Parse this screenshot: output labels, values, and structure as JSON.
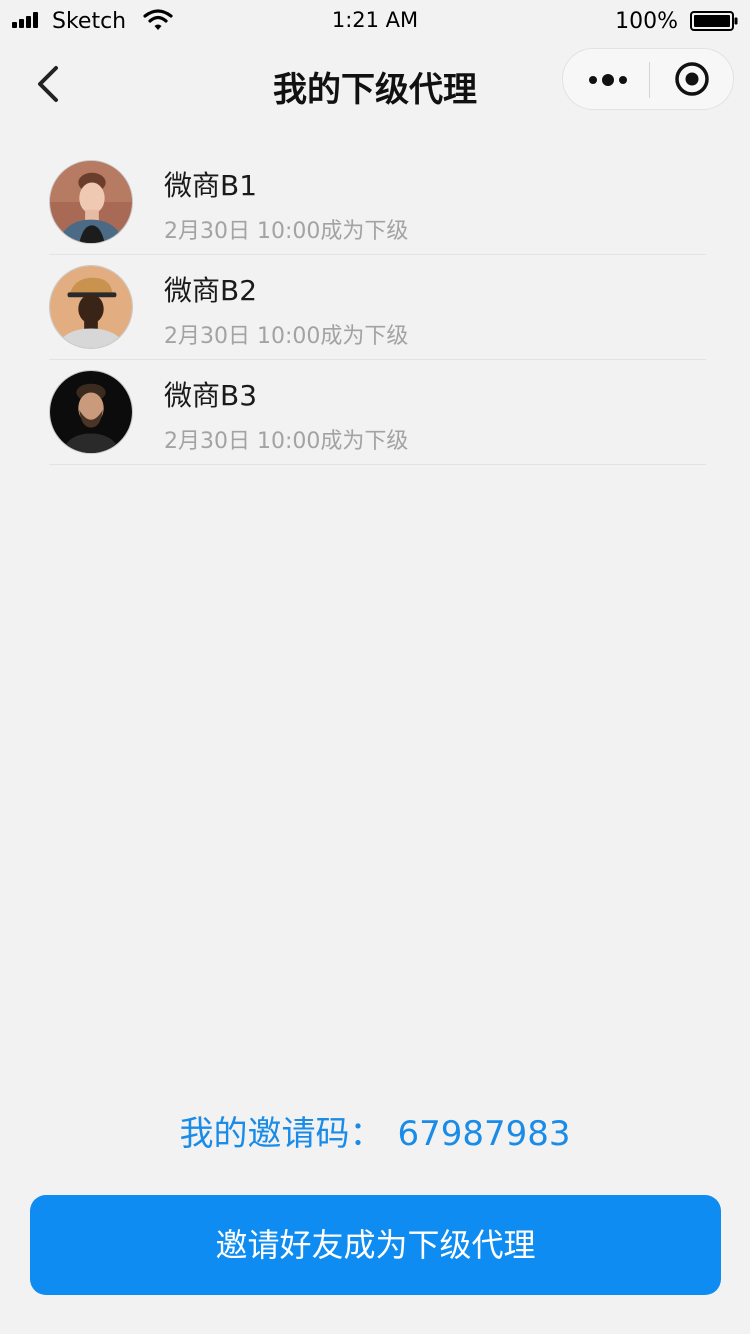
{
  "status_bar": {
    "carrier": "Sketch",
    "time": "1:21 AM",
    "battery_percent": "100%",
    "icons": [
      "signal-icon",
      "wifi-icon",
      "battery-icon"
    ]
  },
  "nav": {
    "title": "我的下级代理",
    "icons": [
      "chevron-left-icon",
      "more-dots-icon",
      "close-target-icon"
    ]
  },
  "agents": [
    {
      "name": "微商B1",
      "time": "2月30日 10:00成为下级",
      "avatar_icon": "avatar-photo-woman"
    },
    {
      "name": "微商B2",
      "time": "2月30日 10:00成为下级",
      "avatar_icon": "avatar-photo-man-cap"
    },
    {
      "name": "微商B3",
      "time": "2月30日 10:00成为下级",
      "avatar_icon": "avatar-photo-man-beard"
    }
  ],
  "invite": {
    "label": "我的邀请码：",
    "code": "67987983",
    "button_label": "邀请好友成为下级代理"
  },
  "colors": {
    "page_bg": "#f2f2f2",
    "accent": "#1a8ce8",
    "button_bg": "#0e8cf2",
    "subtext": "#a3a3a3"
  }
}
